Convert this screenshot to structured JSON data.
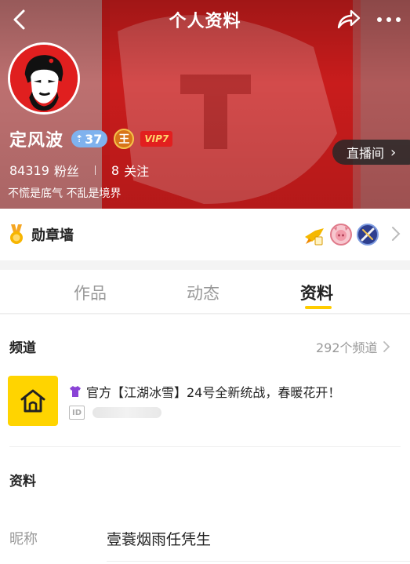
{
  "topbar": {
    "title": "个人资料",
    "back_icon": "back-arrow-icon",
    "share_icon": "share-icon",
    "more_icon": "more-dots-icon"
  },
  "profile": {
    "name": "定风波",
    "level": "37",
    "king_badge": "王",
    "vip": "VIP7",
    "live_button": "直播间",
    "fans_count": "84319",
    "fans_label": "粉丝",
    "following_count": "8",
    "following_label": "关注",
    "bio": "不慌是底气 不乱是境界"
  },
  "medal_wall": {
    "title": "勋章墙",
    "badge_icons": [
      "rocket-medal-icon",
      "pig-medal-icon",
      "sword-medal-icon"
    ]
  },
  "tabs": [
    {
      "label": "作品",
      "active": false
    },
    {
      "label": "动态",
      "active": false
    },
    {
      "label": "资料",
      "active": true
    }
  ],
  "channel_section": {
    "title": "频道",
    "count_link": "292个频道",
    "channel": {
      "name": "官方【江湖冰雪】24号全新统战，春暖花开！",
      "id_label": "ID"
    }
  },
  "info_section": {
    "title": "资料",
    "nickname_label": "昵称",
    "nickname_value": "壹蓑烟雨任凭生"
  },
  "colors": {
    "header_red": "#c91c1c",
    "accent_yellow": "#ffcc00",
    "level_blue": "#7fb2ee",
    "vip_red": "#e21f1f"
  }
}
